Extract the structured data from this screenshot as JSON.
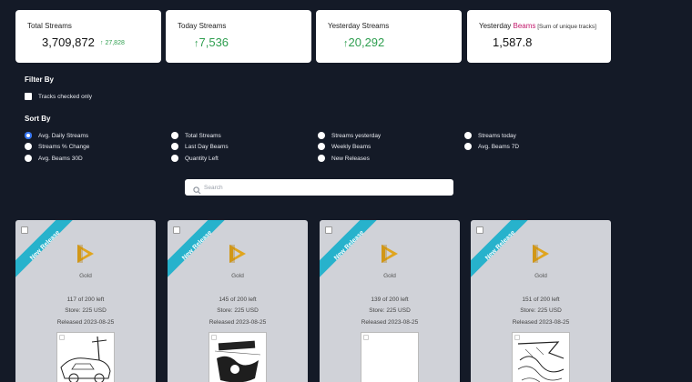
{
  "stats": {
    "total": {
      "label": "Total Streams",
      "value": "3,709,872",
      "delta": "27,828"
    },
    "today": {
      "label": "Today Streams",
      "value": "7,536"
    },
    "yesterday": {
      "label": "Yesterday Streams",
      "value": "20,292"
    },
    "beams": {
      "label_prefix": "Yesterday ",
      "label_accent": "Beams",
      "label_note": " [Sum of unique tracks]",
      "value": "1,587.8"
    }
  },
  "filter": {
    "title": "Filter By",
    "tracks_checked_label": "Tracks checked only"
  },
  "sort": {
    "title": "Sort By",
    "options": [
      {
        "label": "Avg. Daily Streams",
        "selected": true
      },
      {
        "label": "Streams % Change",
        "selected": false
      },
      {
        "label": "Avg. Beams 30D",
        "selected": false
      },
      {
        "label": "Total Streams",
        "selected": false
      },
      {
        "label": "Last Day Beams",
        "selected": false
      },
      {
        "label": "Quantity Left",
        "selected": false
      },
      {
        "label": "Streams yesterday",
        "selected": false
      },
      {
        "label": "Weekly Beams",
        "selected": false
      },
      {
        "label": "New Releases",
        "selected": false
      },
      {
        "label": "Streams today",
        "selected": false
      },
      {
        "label": "Avg. Beams 7D",
        "selected": false
      }
    ]
  },
  "search": {
    "placeholder": "Search",
    "value": ""
  },
  "colors": {
    "background": "#141a27",
    "accent_green": "#2e9e4f",
    "ribbon": "#27b2cc",
    "logo_gold": "#e0a51e",
    "selected_radio": "#2a6ef3",
    "beams_accent": "#c2186b"
  },
  "cards": [
    {
      "ribbon": "New Release",
      "tier": "Gold",
      "quantity": "117 of 200 left",
      "store": "Store: 225 USD",
      "released": "Released 2023-08-25",
      "artwork_icon": "car-sketch-artwork"
    },
    {
      "ribbon": "New Release",
      "tier": "Gold",
      "quantity": "145 of 200 left",
      "store": "Store: 225 USD",
      "released": "Released 2023-08-25",
      "artwork_icon": "abstract-sketch-artwork"
    },
    {
      "ribbon": "New Release",
      "tier": "Gold",
      "quantity": "139 of 200 left",
      "store": "Store: 225 USD",
      "released": "Released 2023-08-25",
      "artwork_icon": "blank-artwork"
    },
    {
      "ribbon": "New Release",
      "tier": "Gold",
      "quantity": "151 of 200 left",
      "store": "Store: 225 USD",
      "released": "Released 2023-08-25",
      "artwork_icon": "wave-sketch-artwork"
    }
  ]
}
